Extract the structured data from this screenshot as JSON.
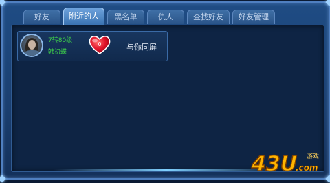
{
  "tabs": [
    {
      "label": "好友",
      "active": false
    },
    {
      "label": "附近的人",
      "active": true
    },
    {
      "label": "黑名单",
      "active": false
    },
    {
      "label": "仇人",
      "active": false
    },
    {
      "label": "查找好友",
      "active": false
    },
    {
      "label": "好友管理",
      "active": false
    }
  ],
  "player_card": {
    "level": "7转80级",
    "name": "韩初蝶",
    "heart_count": "0",
    "status": "与你同屏"
  },
  "watermark": {
    "logo": "43U",
    "suffix": ".com",
    "tag": "游戏"
  },
  "colors": {
    "panel": "#1f4c84",
    "content_bg": "#0e2444",
    "tab_active": "#6da2dc",
    "level_text": "#3fd34a",
    "heart": "#e0142a",
    "logo": "#ffb400"
  }
}
